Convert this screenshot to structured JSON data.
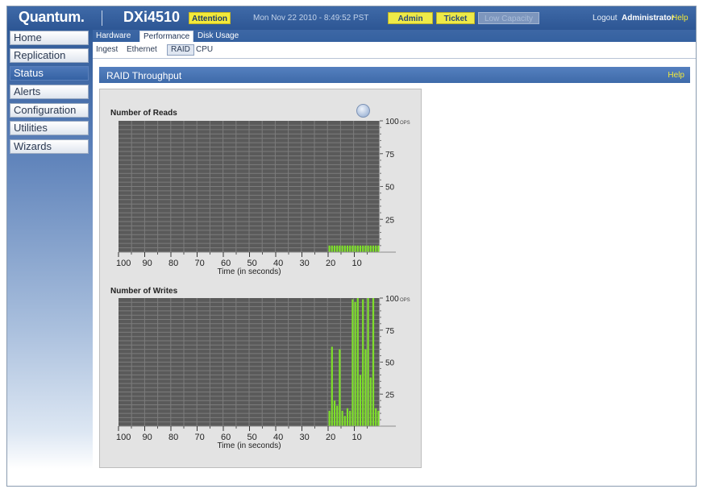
{
  "header": {
    "brand": "Quantum.",
    "model": "DXi4510",
    "attention_label": "Attention",
    "datetime": "Mon Nov 22 2010 - 8:49:52 PST",
    "admin_label": "Admin",
    "ticket_label": "Ticket",
    "low_capacity_label": "Low Capacity",
    "logout_label": "Logout",
    "user": "Administrator",
    "help_label": "Help",
    "colors": {
      "header": "#2d5694",
      "alert_yellow": "#f3e93a"
    }
  },
  "sidebar": {
    "items": [
      {
        "label": "Home"
      },
      {
        "label": "Replication"
      },
      {
        "label": "Status",
        "active": true
      },
      {
        "label": "Alerts"
      },
      {
        "label": "Configuration"
      },
      {
        "label": "Utilities"
      },
      {
        "label": "Wizards"
      }
    ]
  },
  "tabs": {
    "primary": [
      {
        "label": "Hardware"
      },
      {
        "label": "Performance",
        "active": true
      },
      {
        "label": "Disk Usage"
      }
    ],
    "secondary": [
      {
        "label": "Ingest"
      },
      {
        "label": "Ethernet"
      },
      {
        "label": "RAID",
        "active": true
      },
      {
        "label": "CPU"
      }
    ]
  },
  "panel": {
    "title": "RAID Throughput",
    "help_label": "Help",
    "refresh_icon": "refresh-icon"
  },
  "chart_data": [
    {
      "type": "bar",
      "title": "Number of Reads",
      "xlabel": "Time (in seconds)",
      "x_ticks": [
        "100",
        "90",
        "80",
        "70",
        "60",
        "50",
        "40",
        "30",
        "20",
        "10"
      ],
      "y_ticks": [
        "100",
        "75",
        "50",
        "25"
      ],
      "y_unit": "OPS",
      "ylim": [
        0,
        100
      ],
      "bar_color": "#7ee02a",
      "values": [
        5,
        5,
        5,
        5,
        5,
        5,
        5,
        5,
        5,
        5,
        5,
        5,
        5,
        5,
        5,
        5,
        5,
        5,
        5,
        5
      ]
    },
    {
      "type": "bar",
      "title": "Number of Writes",
      "xlabel": "Time (in seconds)",
      "x_ticks": [
        "100",
        "90",
        "80",
        "70",
        "60",
        "50",
        "40",
        "30",
        "20",
        "10"
      ],
      "y_ticks": [
        "100",
        "75",
        "50",
        "25"
      ],
      "y_unit": "OPS",
      "ylim": [
        0,
        100
      ],
      "bar_color": "#7ee02a",
      "values": [
        12,
        62,
        20,
        16,
        60,
        12,
        8,
        14,
        12,
        99,
        97,
        100,
        40,
        99,
        60,
        100,
        38,
        100,
        14,
        12
      ]
    }
  ]
}
